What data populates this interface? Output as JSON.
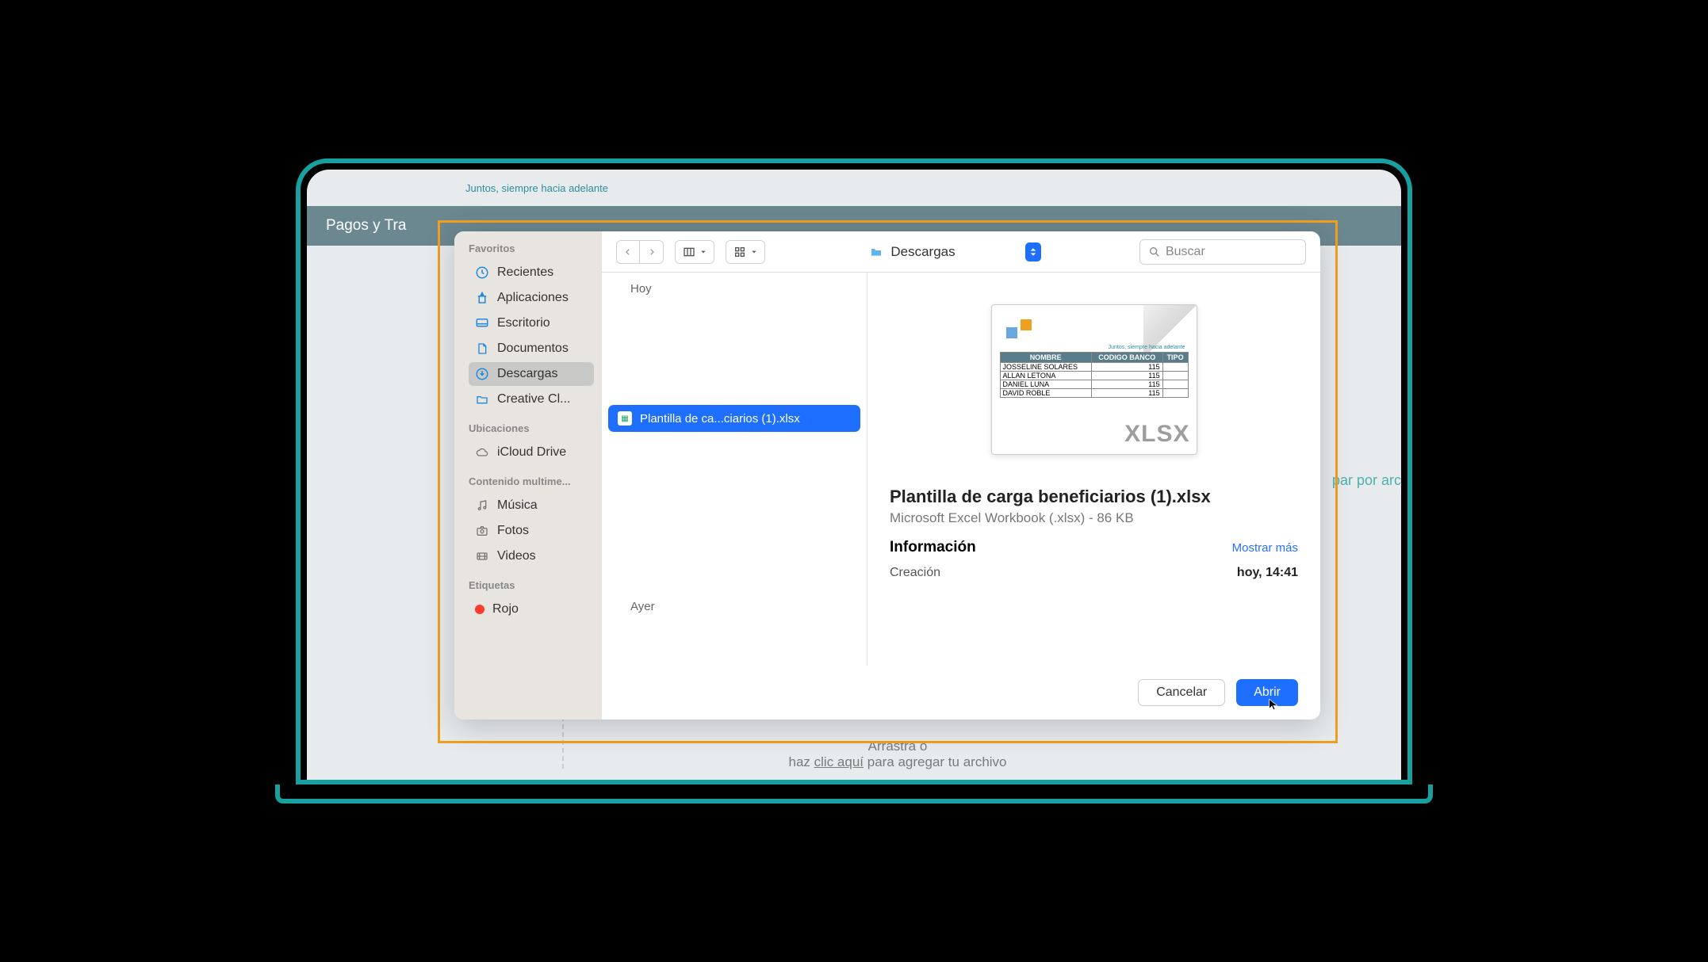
{
  "background": {
    "slogan": "Juntos, siempre hacia adelante",
    "nav_title": "Pagos y Tra",
    "right_text": "par por arc",
    "dropzone_line1": "Arrastra o",
    "dropzone_line2a": "haz ",
    "dropzone_link": "clic aquí",
    "dropzone_line2b": " para agregar tu archivo"
  },
  "sidebar": {
    "favorites_title": "Favoritos",
    "items_fav": [
      {
        "label": "Recientes"
      },
      {
        "label": "Aplicaciones"
      },
      {
        "label": "Escritorio"
      },
      {
        "label": "Documentos"
      },
      {
        "label": "Descargas"
      },
      {
        "label": "Creative Cl..."
      }
    ],
    "locations_title": "Ubicaciones",
    "items_loc": [
      {
        "label": "iCloud Drive"
      }
    ],
    "media_title": "Contenido multime...",
    "items_media": [
      {
        "label": "Música"
      },
      {
        "label": "Fotos"
      },
      {
        "label": "Videos"
      }
    ],
    "tags_title": "Etiquetas",
    "items_tags": [
      {
        "label": "Rojo"
      }
    ]
  },
  "toolbar": {
    "location": "Descargas",
    "search_placeholder": "Buscar"
  },
  "file_list": {
    "section_today": "Hoy",
    "section_yesterday": "Ayer",
    "file_short": "Plantilla de ca...ciarios (1).xlsx"
  },
  "preview": {
    "thumb": {
      "tagline": "Juntos, siempre hacia adelante",
      "cols": [
        "NOMBRE",
        "CODIGO BANCO",
        "TIPO"
      ],
      "rows": [
        [
          "JOSSELINE SOLARES",
          "115",
          ""
        ],
        [
          "ALLAN LETONA",
          "115",
          ""
        ],
        [
          "DANIEL LUNA",
          "115",
          ""
        ],
        [
          "DAVID ROBLE",
          "115",
          ""
        ]
      ],
      "badge": "XLSX"
    },
    "filename": "Plantilla de carga beneficiarios (1).xlsx",
    "subtitle": "Microsoft Excel Workbook (.xlsx) - 86 KB",
    "info_title": "Información",
    "show_more": "Mostrar más",
    "created_label": "Creación",
    "created_value": "hoy, 14:41"
  },
  "footer": {
    "cancel": "Cancelar",
    "open": "Abrir"
  }
}
